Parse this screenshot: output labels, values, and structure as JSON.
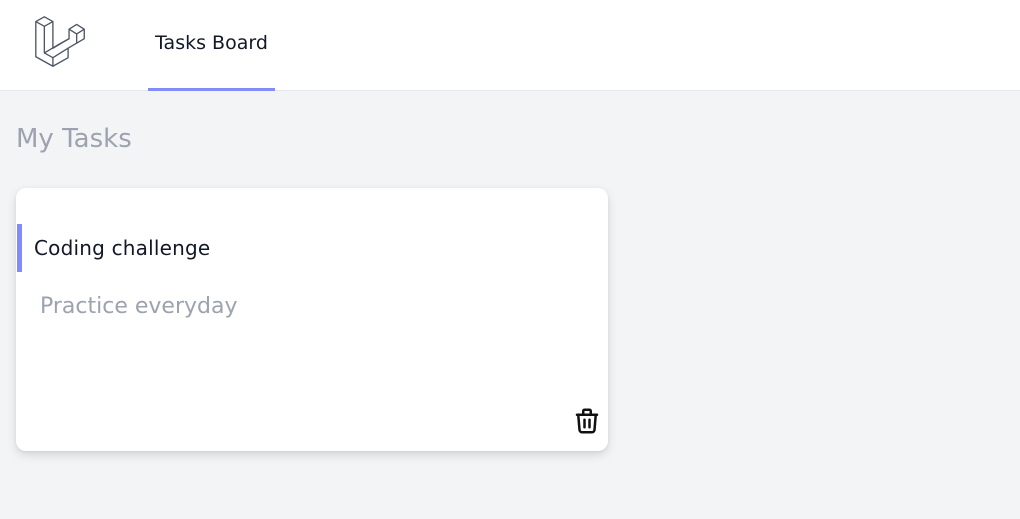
{
  "header": {
    "logo_icon": "laravel-logo-icon",
    "nav": [
      {
        "label": "Tasks Board",
        "active": true
      }
    ],
    "accent_color": "#818cf8"
  },
  "main": {
    "title": "My Tasks",
    "tasks": [
      {
        "title": "Coding challenge",
        "description": "Practice everyday",
        "delete_icon": "trash-icon"
      }
    ]
  }
}
